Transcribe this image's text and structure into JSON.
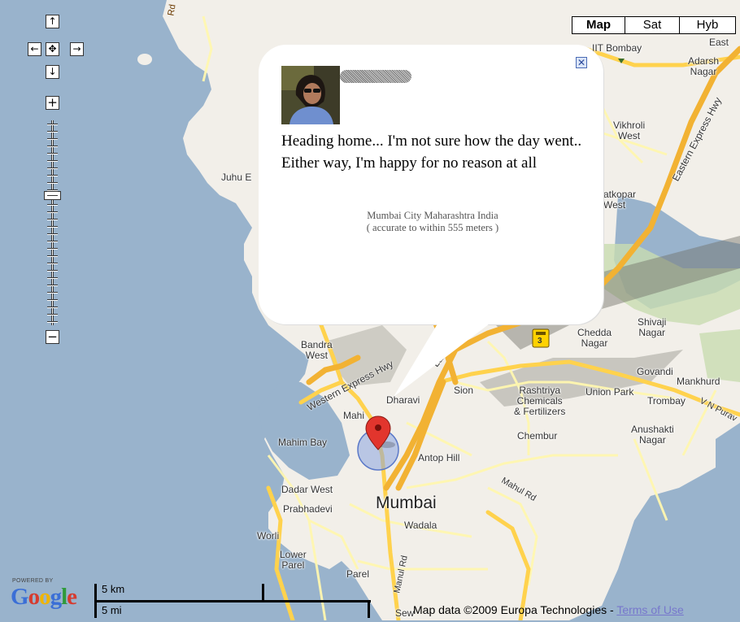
{
  "controls": {
    "pan_up": "↑",
    "pan_left": "←",
    "pan_center": "✥",
    "pan_right": "→",
    "pan_down": "↓",
    "zoom_in": "+",
    "zoom_out": "−"
  },
  "map_types": [
    {
      "label": "Map",
      "active": true
    },
    {
      "label": "Sat",
      "active": false
    },
    {
      "label": "Hyb",
      "active": false
    }
  ],
  "info_window": {
    "close_label": "✕",
    "post_text": "Heading home... I'm not sure how the day went.. Either way, I'm happy for no reason at all",
    "location_line": "Mumbai City Maharashtra India",
    "accuracy_line": "( accurate to within 555 meters )"
  },
  "map_labels": {
    "rd_top": "Rd",
    "iit_bombay": "IIT Bombay",
    "east": "East",
    "adarsh_nagar": "Adarsh\nNagar",
    "vikhroli_west": "Vikhroli\nWest",
    "eastern_express_hwy": "Eastern Express Hwy",
    "ghatkopar_west": "atkopar\nWest",
    "juhu": "Juhu E",
    "shivaji_nagar": "Shivaji\nNagar",
    "chedda_nagar": "Chedda\nNagar",
    "nh3": "3",
    "bandra_west": "Bandra\nWest",
    "western_express_hwy": "Western Express Hwy",
    "lal_bahadur": "Lal Ba",
    "govandi": "Govandi",
    "mankhurd": "Mankhurd",
    "dharavi": "Dharavi",
    "sion": "Sion",
    "rashtriya": "Rashtriya\nChemicals\n& Fertilizers",
    "union_park": "Union Park",
    "trombay": "Trombay",
    "vn_purav": "V N Purav",
    "mahim": "Mahi",
    "mahim_bay": "Mahim Bay",
    "chembur": "Chembur",
    "anushakti_nagar": "Anushakti\nNagar",
    "antop_hill": "Antop Hill",
    "dadar_west": "Dadar West",
    "mumbai": "Mumbai",
    "mahul_rd": "Mahul Rd",
    "prabhadevi": "Prabhadevi",
    "wadala": "Wadala",
    "worli": "Worli",
    "lower_parel": "Lower\nParel",
    "parel": "Parel",
    "manul_rd": "Manul Rd",
    "sewri": "Sew"
  },
  "footer": {
    "powered_by": "POWERED BY",
    "google_logo": "Google",
    "scale_km": "5 km",
    "scale_mi": "5 mi",
    "attribution": "Map data ©2009 Europa Technologies - ",
    "terms_link": "Terms of Use"
  },
  "colors": {
    "water": "#99b3cc",
    "land": "#f2efe9",
    "park": "#c8dcb0",
    "road_major": "#ffd24d",
    "road_minor": "#fff7b0",
    "highway": "#f2b233",
    "marker": "#e2352d",
    "accuracy_circle": "#6f8fd8"
  }
}
